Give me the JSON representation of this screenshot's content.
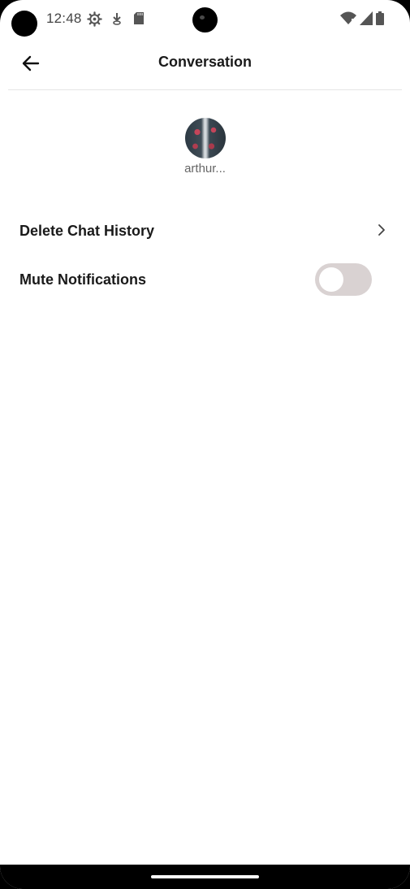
{
  "status_bar": {
    "time": "12:48",
    "icons": [
      "settings-gear-icon",
      "download-icon",
      "sd-card-icon",
      "wifi-icon",
      "signal-icon",
      "battery-icon"
    ]
  },
  "header": {
    "title": "Conversation",
    "back_icon": "arrow-left-icon"
  },
  "profile": {
    "username": "arthur..."
  },
  "settings": {
    "delete_label": "Delete Chat History",
    "mute_label": "Mute Notifications",
    "mute_enabled": false
  },
  "colors": {
    "background": "#ffffff",
    "text": "#1a1a1a",
    "toggle_off": "#d9d2d2"
  }
}
